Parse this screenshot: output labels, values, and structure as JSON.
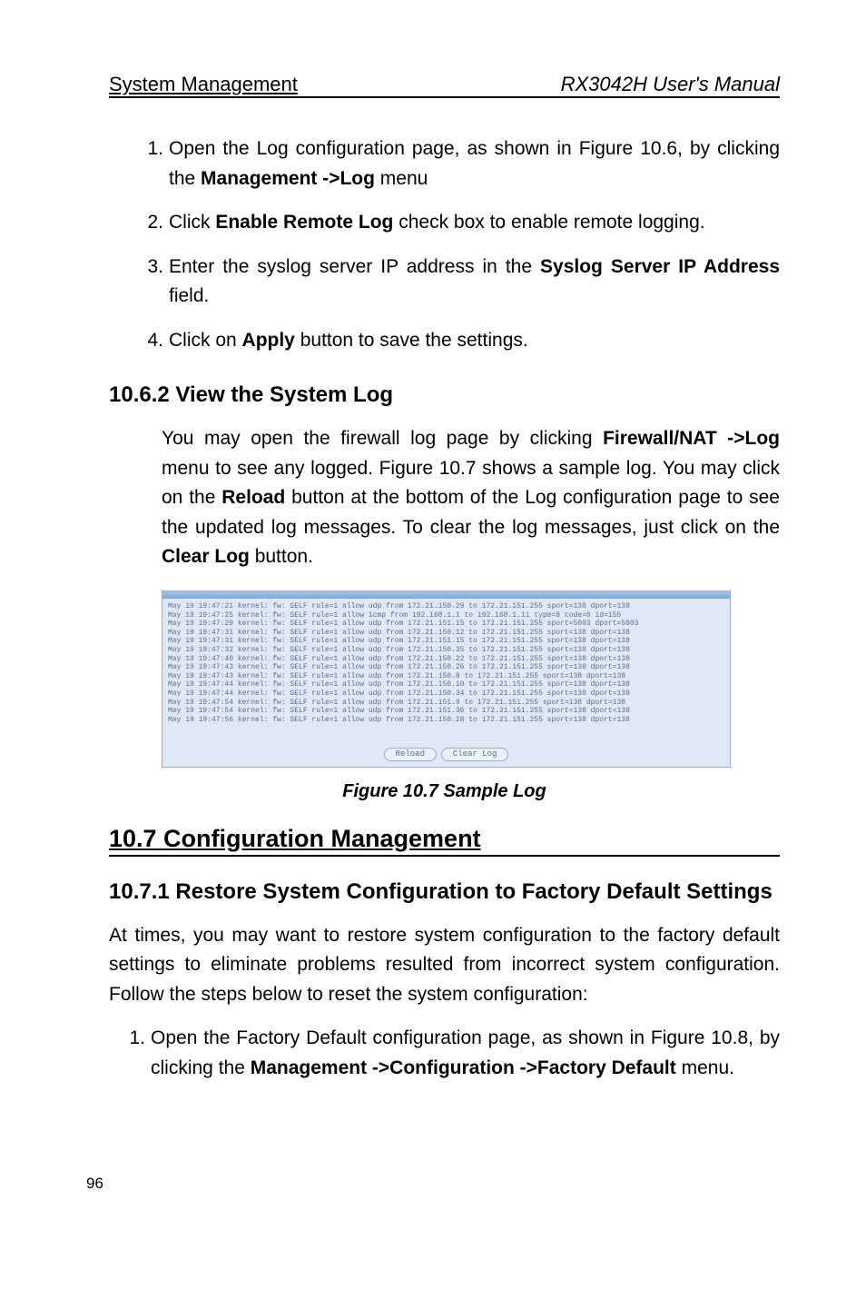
{
  "header": {
    "left": "System Management",
    "right": "RX3042H User's Manual"
  },
  "steps_open_log": [
    {
      "n": "1.",
      "pre": "Open the Log configuration page, as shown in Figure 10.6, by clicking the ",
      "bold": "Management ->Log",
      "post": " menu"
    },
    {
      "n": "2.",
      "pre": "Click ",
      "bold": "Enable Remote Log",
      "post": " check box to enable remote logging."
    },
    {
      "n": "3.",
      "pre": "Enter the syslog server IP address in the ",
      "bold": "Syslog Server IP Address",
      "post": " field."
    },
    {
      "n": "4.",
      "pre": "Click on ",
      "bold": "Apply",
      "post": " button to save the settings."
    }
  ],
  "subhead_view": "10.6.2  View the System Log",
  "view_para": {
    "pre1": "You may open the firewall log page by clicking ",
    "b1": "Firewall/NAT ->Log",
    "mid1": " menu to see any logged. Figure 10.7 shows a sample log. You may click on the ",
    "b2": "Reload",
    "mid2": " button at the bottom of the Log configuration page to see the updated log messages. To clear the log messages, just click on the ",
    "b3": "Clear Log",
    "post": " button."
  },
  "fig10_7": {
    "caption": "Figure 10.7 Sample Log",
    "buttons": {
      "reload": "Reload",
      "clear": "Clear Log"
    },
    "lines": [
      "May 19 19:47:21 kernel: fw: SELF rule=1 allow udp from 172.21.150.29 to 172.21.151.255 sport=138 dport=138",
      "May 19 19:47:25 kernel: fw: SELF rule=1 allow icmp from 192.168.1.1 to 192.168.1.11 type=8 code=0 id=155",
      "May 19 19:47:29 kernel: fw: SELF rule=1 allow udp from 172.21.151.15 to 172.21.151.255 sport=5003 dport=5003",
      "May 19 19:47:31 kernel: fw: SELF rule=1 allow udp from 172.21.150.12 to 172.21.151.255 sport=138 dport=138",
      "May 19 19:47:31 kernel: fw: SELF rule=1 allow udp from 172.21.151.15 to 172.21.151.255 sport=138 dport=138",
      "May 19 19:47:32 kernel: fw: SELF rule=1 allow udp from 172.21.150.35 to 172.21.151.255 sport=138 dport=138",
      "May 19 19:47:40 kernel: fw: SELF rule=1 allow udp from 172.21.150.22 to 172.21.151.255 sport=138 dport=138",
      "May 19 19:47:43 kernel: fw: SELF rule=1 allow udp from 172.21.150.26 to 172.21.151.255 sport=138 dport=138",
      "May 19 19:47:43 kernel: fw: SELF rule=1 allow udp from 172.21.150.8 to 172.21.151.255 sport=138 dport=138",
      "May 19 19:47:44 kernel: fw: SELF rule=1 allow udp from 172.21.150.10 to 172.21.151.255 sport=138 dport=138",
      "May 19 19:47:44 kernel: fw: SELF rule=1 allow udp from 172.21.150.34 to 172.21.151.255 sport=138 dport=138",
      "May 19 19:47:54 kernel: fw: SELF rule=1 allow udp from 172.21.151.9 to 172.21.151.255 sport=138 dport=138",
      "May 19 19:47:54 kernel: fw: SELF rule=1 allow udp from 172.21.151.36 to 172.21.151.255 sport=138 dport=138",
      "May 19 19:47:56 kernel: fw: SELF rule=1 allow udp from 172.21.150.28 to 172.21.151.255 sport=138 dport=138"
    ]
  },
  "sec10_7": "10.7    Configuration Management",
  "subhead_restore": "10.7.1  Restore System Configuration to Factory Default Settings",
  "restore_para": "At times, you may want to restore system configuration to the factory default settings to eliminate problems resulted from incorrect system configuration. Follow the steps below to reset the system configuration:",
  "steps_restore": [
    {
      "n": "1.",
      "pre": "Open the Factory Default configuration page, as shown in Figure 10.8, by clicking the ",
      "bold": "Management ->Configuration ->Factory Default",
      "post": " menu."
    }
  ],
  "pagenum": "96"
}
